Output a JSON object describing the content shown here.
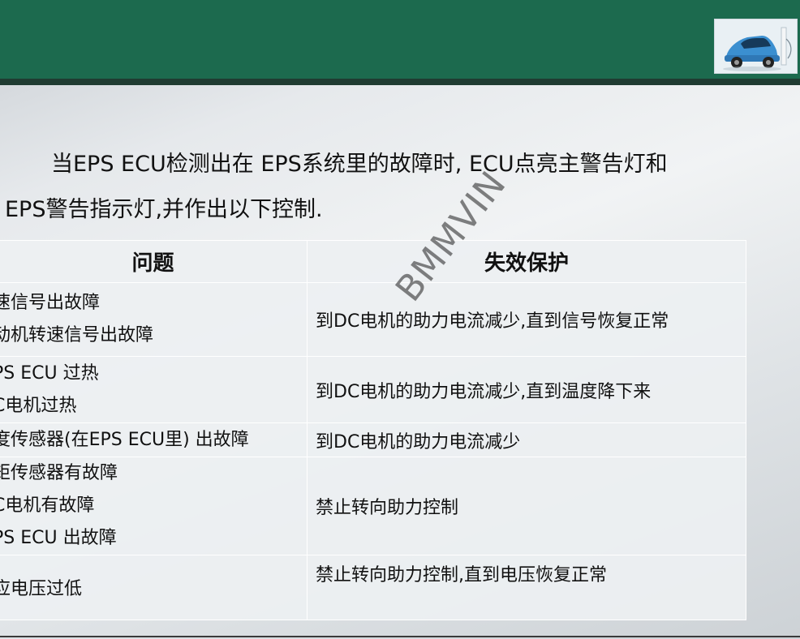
{
  "intro": {
    "line1": "当EPS ECU检测出在 EPS系统里的故障时, ECU点亮主警告灯和",
    "line2": "EPS警告指示灯,并作出以下控制."
  },
  "table": {
    "headers": [
      "问题",
      "失效保护"
    ],
    "rows": [
      {
        "issues": [
          "速信号出故障",
          "动机转速信号出故障"
        ],
        "protection": "到DC电机的助力电流减少,直到信号恢复正常"
      },
      {
        "issues": [
          "PS ECU 过热",
          "C电机过热"
        ],
        "protection": "到DC电机的助力电流减少,直到温度降下来"
      },
      {
        "issues": [
          "度传感器(在EPS ECU里) 出故障"
        ],
        "protection": "到DC电机的助力电流减少"
      },
      {
        "issues": [
          "矩传感器有故障",
          "C电机有故障",
          "PS ECU 出故障"
        ],
        "protection": "禁止转向助力控制"
      },
      {
        "issues": [
          "应电压过低"
        ],
        "protection": "禁止转向助力控制,直到电压恢复正常"
      }
    ]
  },
  "watermark": "BMMVIN",
  "colors": {
    "header": "#1c6a4e",
    "header_stripe": "#203c32"
  },
  "icons": {
    "thumbnail": "car-charging-thumbnail"
  }
}
